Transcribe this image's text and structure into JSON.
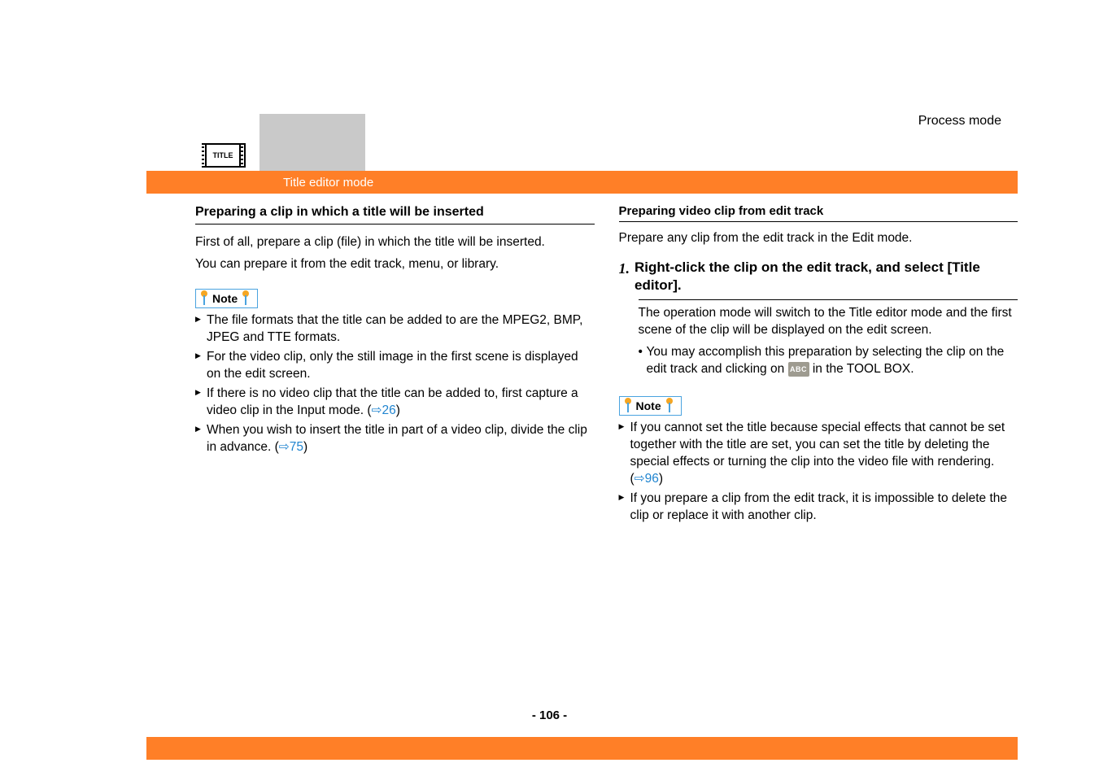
{
  "header": {
    "process_mode": "Process mode",
    "title_icon_text": "TITLE",
    "section_title": "Title editor mode"
  },
  "left": {
    "heading": "Preparing a clip in which a title will be inserted",
    "p1": "First of all, prepare a clip (file) in which the title will be inserted.",
    "p2": "You can prepare it from the edit track, menu, or library.",
    "note_label": "Note",
    "bullets": {
      "b1": "The file formats that the title can be added to are the MPEG2, BMP, JPEG and TTE formats.",
      "b2": "For the video clip, only the still image in the first scene is displayed on the edit screen.",
      "b3_a": "If there is no video clip that the title can be added to, first capture a video clip in the Input mode. (",
      "b3_link": "⇨26",
      "b3_b": ")",
      "b4_a": "When you wish to insert the title in part of a video clip, divide the clip in advance. (",
      "b4_link": "⇨75",
      "b4_b": ")"
    }
  },
  "right": {
    "subheading": "Preparing video clip from edit track",
    "p1": "Prepare any clip from the edit track in the Edit mode.",
    "step1_num": "1.",
    "step1_text": "Right-click the clip on the edit track, and select [Title editor].",
    "step1_body": "The operation mode will switch to the Title editor mode and the first scene of the clip will be displayed on the edit screen.",
    "step1_sub_a": "You may accomplish this preparation by selecting the clip on the edit track and clicking on ",
    "step1_abc": "ABC",
    "step1_sub_b": " in the TOOL BOX.",
    "note_label": "Note",
    "bullets": {
      "b1_a": "If you cannot set the title because special effects that cannot be set together with the title are set, you can set the title by deleting the special effects or turning the clip into the video file with rendering. (",
      "b1_link": "⇨96",
      "b1_b": ")",
      "b2": "If you prepare a clip from the edit track, it is impossible to delete the clip or replace it with another clip."
    }
  },
  "footer": {
    "page_num": "- 106 -"
  }
}
